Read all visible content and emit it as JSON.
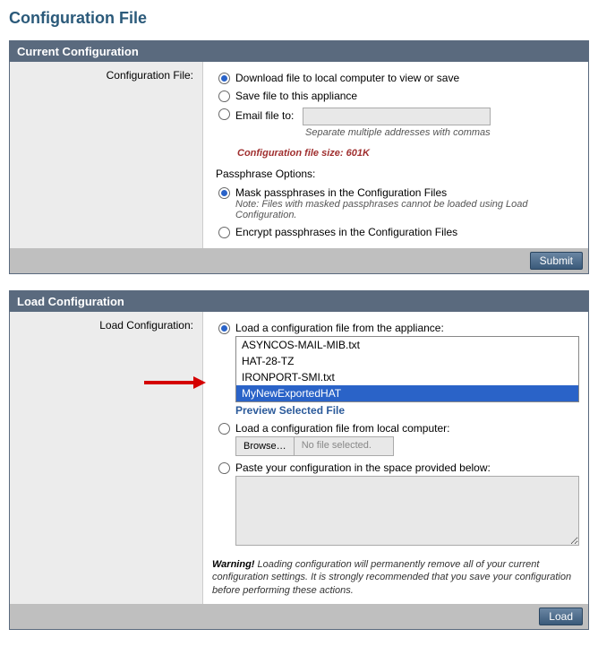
{
  "page": {
    "title": "Configuration File"
  },
  "current": {
    "panel_title": "Current Configuration",
    "label": "Configuration File:",
    "opts": {
      "download": "Download file to local computer to view or save",
      "save": "Save file to this appliance",
      "email": "Email file to:",
      "email_value": "",
      "email_note": "Separate multiple addresses with commas"
    },
    "size_note": "Configuration file size: 601K",
    "pass_section": "Passphrase Options:",
    "pass": {
      "mask": "Mask passphrases in the Configuration Files",
      "mask_note": "Note: Files with masked passphrases cannot be loaded using Load Configuration.",
      "encrypt": "Encrypt passphrases in the Configuration Files"
    },
    "submit": "Submit"
  },
  "load": {
    "panel_title": "Load Configuration",
    "label": "Load Configuration:",
    "opt_appliance": "Load a configuration file from the appliance:",
    "files": [
      {
        "name": "ASYNCOS-MAIL-MIB.txt",
        "selected": false
      },
      {
        "name": "HAT-28-TZ",
        "selected": false
      },
      {
        "name": "IRONPORT-SMI.txt",
        "selected": false
      },
      {
        "name": "MyNewExportedHAT",
        "selected": true
      }
    ],
    "preview": "Preview Selected File",
    "opt_local": "Load a configuration file from local computer:",
    "browse_btn": "Browse…",
    "browse_text": "No file selected.",
    "opt_paste": "Paste your configuration in the space provided below:",
    "paste_value": "",
    "warning_label": "Warning!",
    "warning_text": " Loading configuration will permanently remove all of your current configuration settings. It is strongly recommended that you save your configuration before performing these actions.",
    "load_btn": "Load"
  }
}
